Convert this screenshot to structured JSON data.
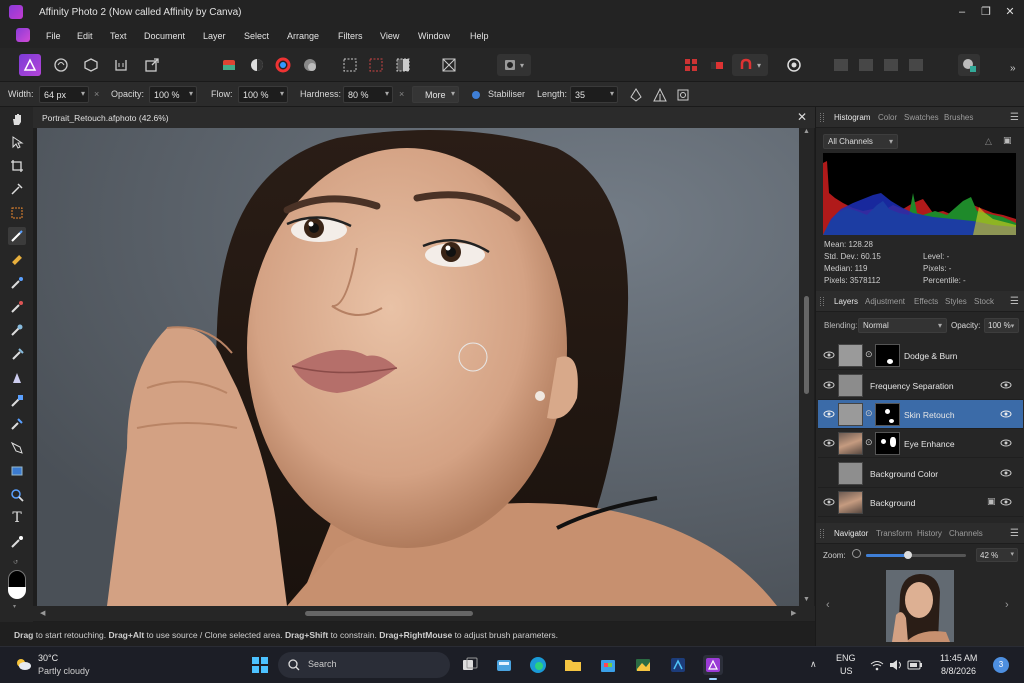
{
  "window": {
    "title": "Affinity Photo 2 (Now called Affinity by Canva)"
  },
  "menu": [
    "File",
    "Edit",
    "Text",
    "Document",
    "Layer",
    "Select",
    "Arrange",
    "Filters",
    "View",
    "Window",
    "Help"
  ],
  "context_toolbar": {
    "width_label": "Width:",
    "width_value": "64 px",
    "opacity_label": "Opacity:",
    "opacity_value": "100 %",
    "flow_label": "Flow:",
    "flow_value": "100 %",
    "hardness_label": "Hardness:",
    "hardness_value": "80 %",
    "more_label": "More",
    "stabiliser_label": "Stabiliser",
    "length_label": "Length:",
    "length_value": "35"
  },
  "document": {
    "tab_name": "Portrait_Retouch.afphoto (42.6%)"
  },
  "status": {
    "p1": "Drag",
    "t1": " to start retouching. ",
    "p2": "Drag+Alt",
    "t2": " to use source / Clone selected area. ",
    "p3": "Drag+Shift",
    "t3": " to constrain. ",
    "p4": "Drag+RightMouse",
    "t4": " to adjust brush parameters."
  },
  "histogram_panel": {
    "tabs": [
      "Histogram",
      "Color",
      "Swatches",
      "Brushes"
    ],
    "channel": "All Channels",
    "mean": "Mean: 128.28",
    "std_dev": "Std. Dev.: 60.15",
    "median": "Median: 119",
    "pixels": "Pixels: 3578112",
    "level": "Level: -",
    "pixels_right": "Pixels: -",
    "percentile": "Percentile: -"
  },
  "layers_panel": {
    "tabs": [
      "Layers",
      "Adjustment",
      "Effects",
      "Styles",
      "Stock"
    ],
    "blend_label": "Blending:",
    "blend_mode": "Normal",
    "opacity_label": "Opacity:",
    "opacity_value": "100 %",
    "layers": [
      {
        "name": "Dodge & Burn"
      },
      {
        "name": "Frequency Separation"
      },
      {
        "name": "Skin Retouch"
      },
      {
        "name": "Eye Enhance"
      },
      {
        "name": "Background Color"
      },
      {
        "name": "Background"
      }
    ]
  },
  "navigator_panel": {
    "tabs": [
      "Navigator",
      "Transform",
      "History",
      "Channels"
    ],
    "zoom_label": "Zoom:",
    "zoom_value": "42 %",
    "zoom_fraction": 0.42
  },
  "taskbar": {
    "temperature": "30°C",
    "weather": "Partly cloudy",
    "search_placeholder": "Search",
    "lang1": "ENG",
    "lang2": "US",
    "time": "11:45 AM",
    "date": "8/8/2026",
    "notifications": "3"
  },
  "colors": {
    "accent": "#3b6ba8",
    "brand": "#9b3bd6"
  }
}
